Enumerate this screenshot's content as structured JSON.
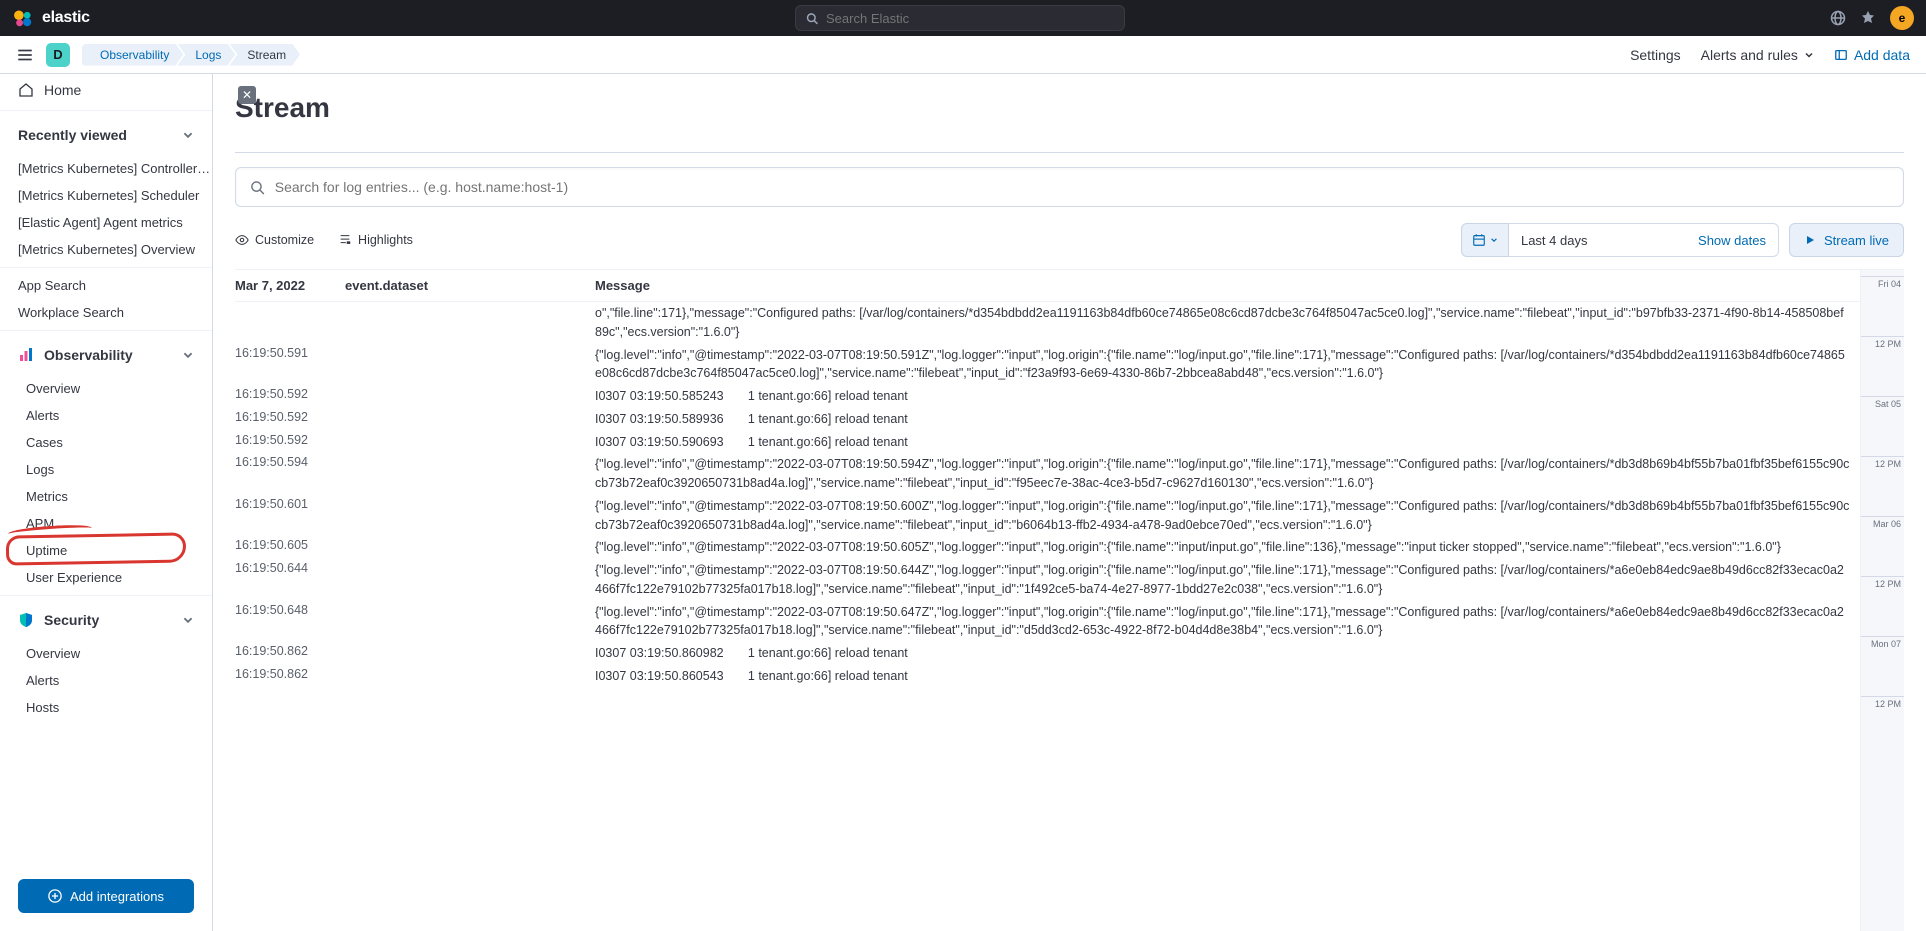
{
  "brand": "elastic",
  "top_search_placeholder": "Search Elastic",
  "avatar_letter": "e",
  "space_letter": "D",
  "breadcrumbs": [
    "Observability",
    "Logs",
    "Stream"
  ],
  "header_links": {
    "settings": "Settings",
    "alerts": "Alerts and rules",
    "add_data": "Add data"
  },
  "sidebar": {
    "home": "Home",
    "recently_viewed": "Recently viewed",
    "recent_items": [
      "[Metrics Kubernetes] Controller…",
      "[Metrics Kubernetes] Scheduler",
      "[Elastic Agent] Agent metrics",
      "[Metrics Kubernetes] Overview"
    ],
    "app_search": "App Search",
    "workplace_search": "Workplace Search",
    "observability": "Observability",
    "obs_items": [
      "Overview",
      "Alerts",
      "Cases",
      "Logs",
      "Metrics",
      "APM",
      "Uptime",
      "User Experience"
    ],
    "security": "Security",
    "sec_items": [
      "Overview",
      "Alerts",
      "Hosts"
    ],
    "add_integrations": "Add integrations"
  },
  "page": {
    "title": "Stream",
    "search_placeholder": "Search for log entries... (e.g. host.name:host-1)",
    "customize": "Customize",
    "highlights": "Highlights",
    "date_range": "Last 4 days",
    "show_dates": "Show dates",
    "stream_live": "Stream live"
  },
  "columns": {
    "date": "Mar 7, 2022",
    "dataset": "event.dataset",
    "message": "Message"
  },
  "minimap": [
    "Fri 04",
    "12 PM",
    "Sat 05",
    "12 PM",
    "Mar 06",
    "12 PM",
    "Mon 07",
    "12 PM"
  ],
  "logs": [
    {
      "ts": "",
      "msg": "o\",\"file.line\":171},\"message\":\"Configured paths: [/var/log/containers/*d354bdbdd2ea1191163b84dfb60ce74865e08c6cd87dcbe3c764f85047ac5ce0.log]\",\"service.name\":\"filebeat\",\"input_id\":\"b97bfb33-2371-4f90-8b14-458508bef89c\",\"ecs.version\":\"1.6.0\"}"
    },
    {
      "ts": "16:19:50.591",
      "msg": "{\"log.level\":\"info\",\"@timestamp\":\"2022-03-07T08:19:50.591Z\",\"log.logger\":\"input\",\"log.origin\":{\"file.name\":\"log/input.go\",\"file.line\":171},\"message\":\"Configured paths: [/var/log/containers/*d354bdbdd2ea1191163b84dfb60ce74865e08c6cd87dcbe3c764f85047ac5ce0.log]\",\"service.name\":\"filebeat\",\"input_id\":\"f23a9f93-6e69-4330-86b7-2bbcea8abd48\",\"ecs.version\":\"1.6.0\"}"
    },
    {
      "ts": "16:19:50.592",
      "msg": "I0307 03:19:50.585243       1 tenant.go:66] reload tenant"
    },
    {
      "ts": "16:19:50.592",
      "msg": "I0307 03:19:50.589936       1 tenant.go:66] reload tenant"
    },
    {
      "ts": "16:19:50.592",
      "msg": "I0307 03:19:50.590693       1 tenant.go:66] reload tenant"
    },
    {
      "ts": "16:19:50.594",
      "msg": "{\"log.level\":\"info\",\"@timestamp\":\"2022-03-07T08:19:50.594Z\",\"log.logger\":\"input\",\"log.origin\":{\"file.name\":\"log/input.go\",\"file.line\":171},\"message\":\"Configured paths: [/var/log/containers/*db3d8b69b4bf55b7ba01fbf35bef6155c90ccb73b72eaf0c3920650731b8ad4a.log]\",\"service.name\":\"filebeat\",\"input_id\":\"f95eec7e-38ac-4ce3-b5d7-c9627d160130\",\"ecs.version\":\"1.6.0\"}"
    },
    {
      "ts": "16:19:50.601",
      "msg": "{\"log.level\":\"info\",\"@timestamp\":\"2022-03-07T08:19:50.600Z\",\"log.logger\":\"input\",\"log.origin\":{\"file.name\":\"log/input.go\",\"file.line\":171},\"message\":\"Configured paths: [/var/log/containers/*db3d8b69b4bf55b7ba01fbf35bef6155c90ccb73b72eaf0c3920650731b8ad4a.log]\",\"service.name\":\"filebeat\",\"input_id\":\"b6064b13-ffb2-4934-a478-9ad0ebce70ed\",\"ecs.version\":\"1.6.0\"}"
    },
    {
      "ts": "16:19:50.605",
      "msg": "{\"log.level\":\"info\",\"@timestamp\":\"2022-03-07T08:19:50.605Z\",\"log.logger\":\"input\",\"log.origin\":{\"file.name\":\"input/input.go\",\"file.line\":136},\"message\":\"input ticker stopped\",\"service.name\":\"filebeat\",\"ecs.version\":\"1.6.0\"}"
    },
    {
      "ts": "16:19:50.644",
      "msg": "{\"log.level\":\"info\",\"@timestamp\":\"2022-03-07T08:19:50.644Z\",\"log.logger\":\"input\",\"log.origin\":{\"file.name\":\"log/input.go\",\"file.line\":171},\"message\":\"Configured paths: [/var/log/containers/*a6e0eb84edc9ae8b49d6cc82f33ecac0a2466f7fc122e79102b77325fa017b18.log]\",\"service.name\":\"filebeat\",\"input_id\":\"1f492ce5-ba74-4e27-8977-1bdd27e2c038\",\"ecs.version\":\"1.6.0\"}"
    },
    {
      "ts": "16:19:50.648",
      "msg": "{\"log.level\":\"info\",\"@timestamp\":\"2022-03-07T08:19:50.647Z\",\"log.logger\":\"input\",\"log.origin\":{\"file.name\":\"log/input.go\",\"file.line\":171},\"message\":\"Configured paths: [/var/log/containers/*a6e0eb84edc9ae8b49d6cc82f33ecac0a2466f7fc122e79102b77325fa017b18.log]\",\"service.name\":\"filebeat\",\"input_id\":\"d5dd3cd2-653c-4922-8f72-b04d4d8e38b4\",\"ecs.version\":\"1.6.0\"}"
    },
    {
      "ts": "16:19:50.862",
      "msg": "I0307 03:19:50.860982       1 tenant.go:66] reload tenant"
    },
    {
      "ts": "16:19:50.862",
      "msg": "I0307 03:19:50.860543       1 tenant.go:66] reload tenant"
    }
  ]
}
